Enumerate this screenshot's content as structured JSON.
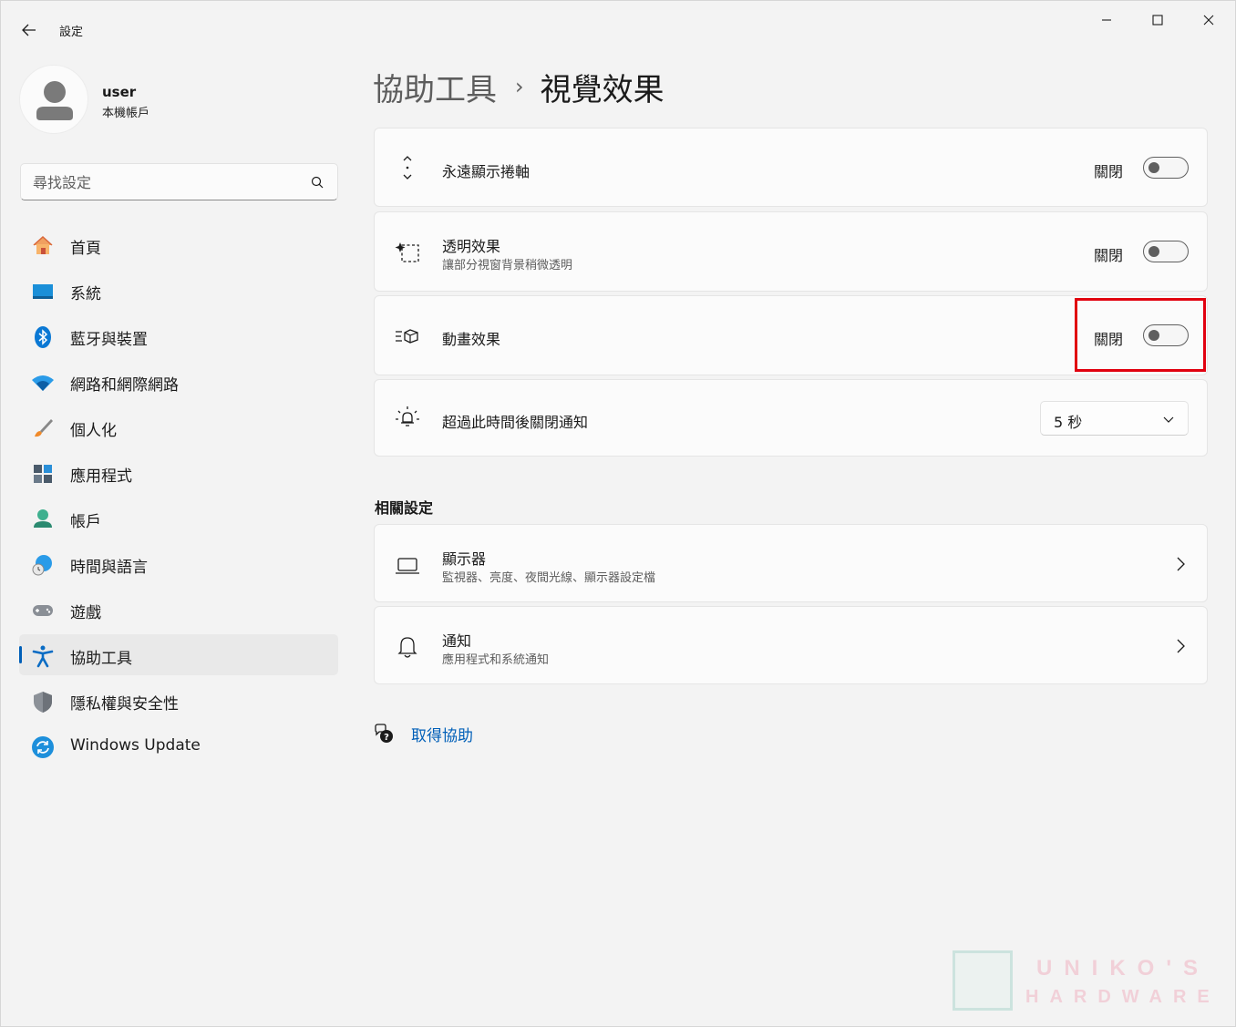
{
  "window": {
    "title": "設定"
  },
  "profile": {
    "name": "user",
    "account_type": "本機帳戶"
  },
  "search": {
    "placeholder": "尋找設定"
  },
  "sidebar": {
    "items": [
      {
        "label": "首頁",
        "icon": "home-icon"
      },
      {
        "label": "系統",
        "icon": "system-icon"
      },
      {
        "label": "藍牙與裝置",
        "icon": "bluetooth-icon"
      },
      {
        "label": "網路和網際網路",
        "icon": "wifi-icon"
      },
      {
        "label": "個人化",
        "icon": "brush-icon"
      },
      {
        "label": "應用程式",
        "icon": "apps-icon"
      },
      {
        "label": "帳戶",
        "icon": "account-icon"
      },
      {
        "label": "時間與語言",
        "icon": "globe-clock-icon"
      },
      {
        "label": "遊戲",
        "icon": "gamepad-icon"
      },
      {
        "label": "協助工具",
        "icon": "accessibility-icon",
        "selected": true
      },
      {
        "label": "隱私權與安全性",
        "icon": "shield-icon"
      },
      {
        "label": "Windows Update",
        "icon": "update-icon"
      }
    ]
  },
  "breadcrumb": {
    "parent": "協助工具",
    "separator": "›",
    "current": "視覺效果"
  },
  "settings": {
    "scrollbars": {
      "title": "永遠顯示捲軸",
      "state": "關閉",
      "on": false
    },
    "transparency": {
      "title": "透明效果",
      "subtitle": "讓部分視窗背景稍微透明",
      "state": "關閉",
      "on": false
    },
    "animation": {
      "title": "動畫效果",
      "state": "關閉",
      "on": false
    },
    "notification_timeout": {
      "title": "超過此時間後關閉通知",
      "value": "5 秒"
    }
  },
  "related": {
    "section_title": "相關設定",
    "display": {
      "title": "顯示器",
      "subtitle": "監視器、亮度、夜間光線、顯示器設定檔"
    },
    "notifications": {
      "title": "通知",
      "subtitle": "應用程式和系統通知"
    }
  },
  "help": {
    "label": "取得協助"
  },
  "watermark": {
    "line1": "UNIKO'S",
    "line2": "HARDWARE"
  },
  "colors": {
    "accent": "#005fb8",
    "highlight": "#e1000f",
    "background": "#f3f3f3",
    "card": "#fbfbfb"
  }
}
